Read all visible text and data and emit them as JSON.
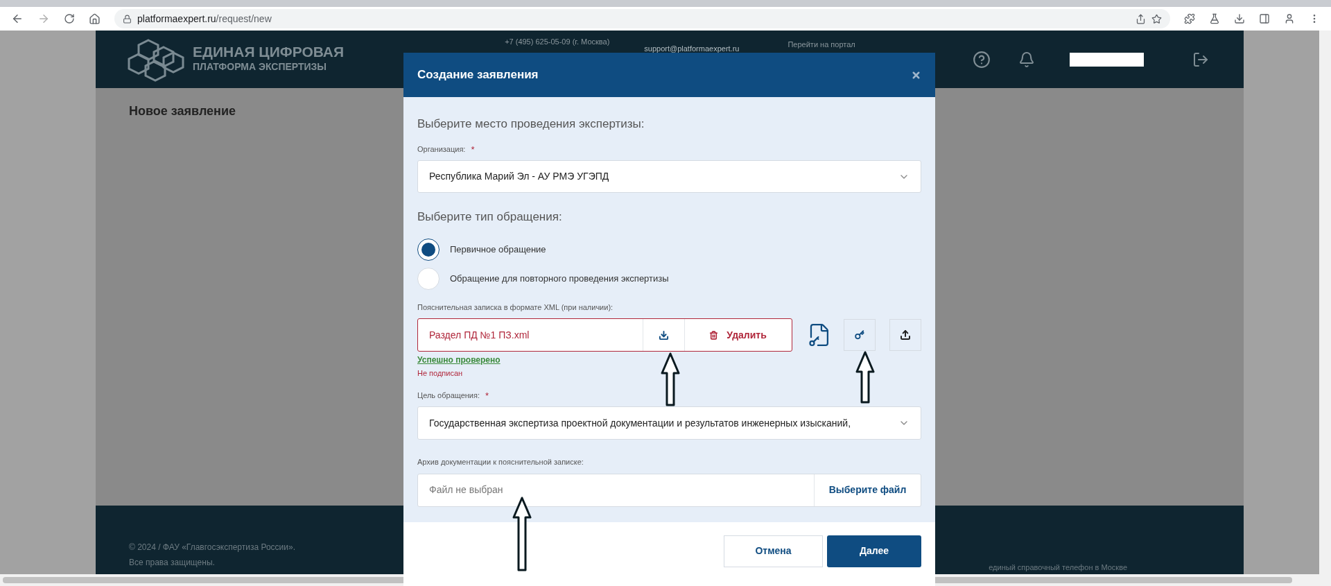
{
  "browser": {
    "url_host": "platformaexpert.ru",
    "url_path": "/request/new"
  },
  "header": {
    "logo_line1": "ЕДИНАЯ ЦИФРОВАЯ",
    "logo_line2": "ПЛАТФОРМА ЭКСПЕРТИЗЫ",
    "phone": "+7 (495) 625-05-09 (г. Москва)",
    "email": "support@platformaexpert.ru",
    "portal_link": "Перейти на портал"
  },
  "page": {
    "title": "Новое заявление"
  },
  "footer": {
    "copyright": "© 2024 / ФАУ «Главгосэкспертиза России».",
    "rights": "Все права защищены.",
    "phone_label": "единый справочный телефон в Москве"
  },
  "modal": {
    "title": "Создание заявления",
    "place_heading": "Выберите место проведения экспертизы:",
    "organization": {
      "label": "Организация:",
      "required_mark": "*",
      "value": "Республика Марий Эл - АУ РМЭ УГЭПД"
    },
    "type_heading": "Выберите тип обращения:",
    "types": [
      {
        "label": "Первичное обращение",
        "selected": true
      },
      {
        "label": "Обращение для повторного проведения экспертизы",
        "selected": false
      }
    ],
    "xml": {
      "label": "Пояснительная записка в формате XML (при наличии):",
      "file_name": "Раздел ПД №1 ПЗ.xml",
      "delete_label": "Удалить",
      "validation": "Успешно проверено",
      "signature": "Не подписан"
    },
    "purpose": {
      "label": "Цель обращения:",
      "required_mark": "*",
      "value": "Государственная экспертиза проектной документации и результатов инженерных изысканий,"
    },
    "archive": {
      "label": "Архив документации к пояснительной записке:",
      "placeholder": "Файл не выбран",
      "button": "Выберите файл"
    },
    "buttons": {
      "cancel": "Отмена",
      "next": "Далее"
    }
  }
}
